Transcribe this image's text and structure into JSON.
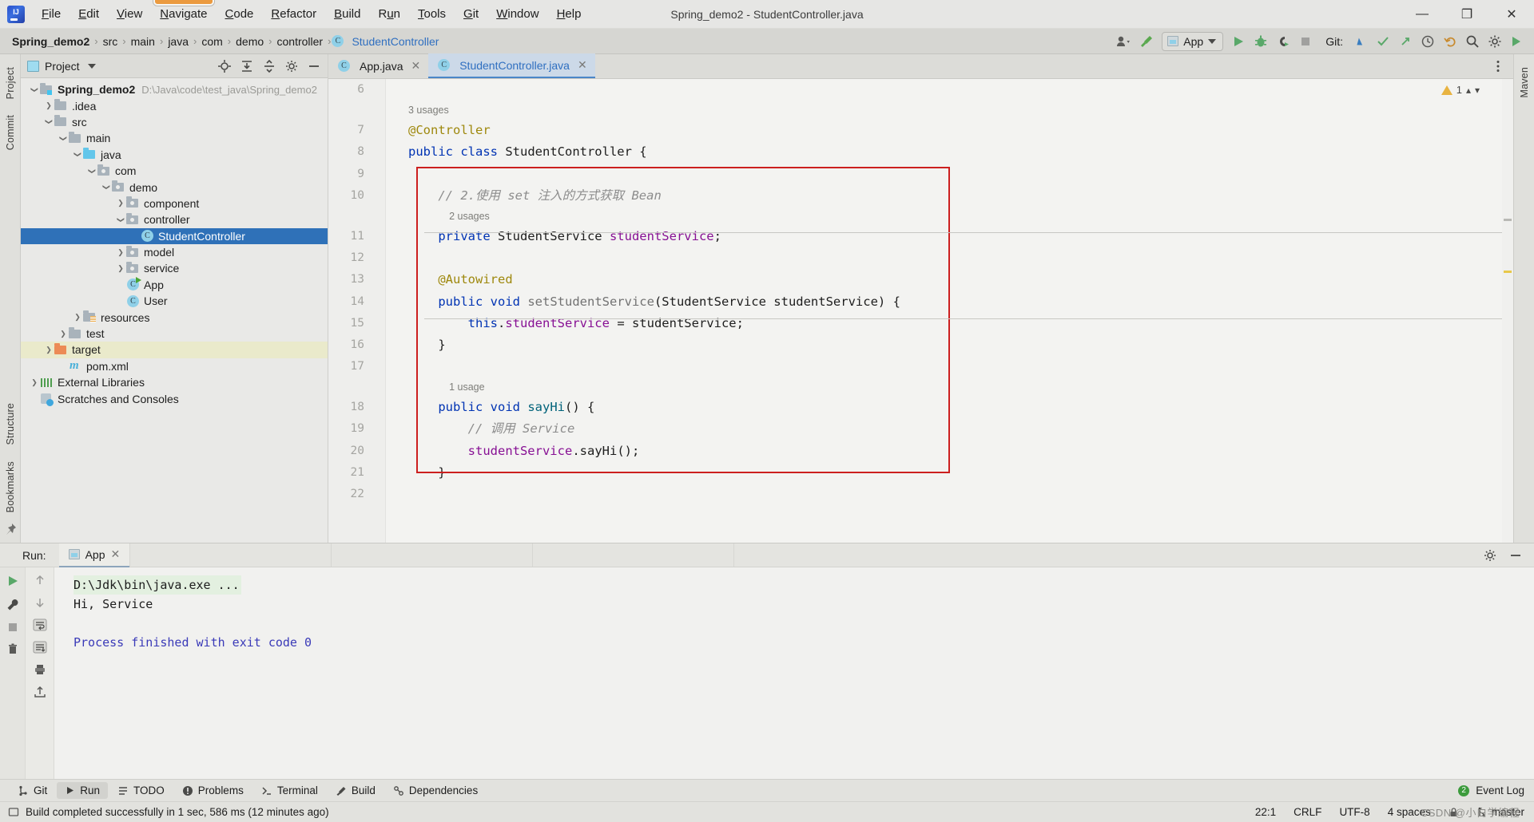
{
  "titlebar": {
    "app_icon": "intellij-logo-icon",
    "menus": [
      {
        "label": "File",
        "accel": "F"
      },
      {
        "label": "Edit",
        "accel": "E"
      },
      {
        "label": "View",
        "accel": "V"
      },
      {
        "label": "Navigate",
        "accel": "N",
        "selected": true
      },
      {
        "label": "Code",
        "accel": "C"
      },
      {
        "label": "Refactor",
        "accel": "R"
      },
      {
        "label": "Build",
        "accel": "B"
      },
      {
        "label": "Run",
        "accel": "u"
      },
      {
        "label": "Tools",
        "accel": "T"
      },
      {
        "label": "Git",
        "accel": "G"
      },
      {
        "label": "Window",
        "accel": "W"
      },
      {
        "label": "Help",
        "accel": "H"
      }
    ],
    "window_title": "Spring_demo2 - StudentController.java",
    "minimize": "—",
    "maximize": "❐",
    "close": "✕"
  },
  "navbar": {
    "breadcrumbs": [
      "Spring_demo2",
      "src",
      "main",
      "java",
      "com",
      "demo",
      "controller",
      "StudentController"
    ],
    "separator": "›",
    "class_badge": "C",
    "run_config": {
      "name": "App",
      "icon": "run-configuration-icon"
    },
    "git_label": "Git:",
    "icons": [
      "user-avatar-icon",
      "build-hammer-icon",
      "run-icon",
      "debug-icon",
      "run-with-coverage-icon",
      "stop-icon",
      "git-update-icon",
      "git-commit-icon",
      "git-push-icon",
      "history-icon",
      "undo-icon",
      "search-icon",
      "settings-icon",
      "plugin-icon"
    ]
  },
  "left_strip": {
    "tabs": [
      "Project",
      "Commit",
      "Structure",
      "Bookmarks"
    ],
    "pin_icon": "pin-icon"
  },
  "right_strip": {
    "tabs": [
      "Maven"
    ]
  },
  "project_panel": {
    "title": "Project",
    "actions": [
      "locate-icon",
      "expand-all-icon",
      "collapse-all-icon",
      "settings-icon",
      "hide-icon"
    ],
    "tree": [
      {
        "label": "Spring_demo2",
        "path": "D:\\Java\\code\\test_java\\Spring_demo2",
        "depth": 0,
        "arrow": "open",
        "icon": "project-folder",
        "bold": true
      },
      {
        "label": ".idea",
        "depth": 1,
        "arrow": "closed",
        "icon": "folder"
      },
      {
        "label": "src",
        "depth": 1,
        "arrow": "open",
        "icon": "folder"
      },
      {
        "label": "main",
        "depth": 2,
        "arrow": "open",
        "icon": "folder"
      },
      {
        "label": "java",
        "depth": 3,
        "arrow": "open",
        "icon": "folder-blue"
      },
      {
        "label": "com",
        "depth": 4,
        "arrow": "open",
        "icon": "package"
      },
      {
        "label": "demo",
        "depth": 5,
        "arrow": "open",
        "icon": "package"
      },
      {
        "label": "component",
        "depth": 6,
        "arrow": "closed",
        "icon": "package"
      },
      {
        "label": "controller",
        "depth": 6,
        "arrow": "open",
        "icon": "package"
      },
      {
        "label": "StudentController",
        "depth": 7,
        "arrow": "none",
        "icon": "class",
        "selected": true
      },
      {
        "label": "model",
        "depth": 6,
        "arrow": "closed",
        "icon": "package"
      },
      {
        "label": "service",
        "depth": 6,
        "arrow": "closed",
        "icon": "package"
      },
      {
        "label": "App",
        "depth": 6,
        "arrow": "none",
        "icon": "class-runnable"
      },
      {
        "label": "User",
        "depth": 6,
        "arrow": "none",
        "icon": "class"
      },
      {
        "label": "resources",
        "depth": 3,
        "arrow": "closed",
        "icon": "folder-resources"
      },
      {
        "label": "test",
        "depth": 2,
        "arrow": "closed",
        "icon": "folder"
      },
      {
        "label": "target",
        "depth": 1,
        "arrow": "closed",
        "icon": "folder-orange",
        "highlight": true
      },
      {
        "label": "pom.xml",
        "depth": 2,
        "arrow": "none",
        "icon": "maven"
      },
      {
        "label": "External Libraries",
        "depth": 0,
        "arrow": "closed",
        "icon": "library"
      },
      {
        "label": "Scratches and Consoles",
        "depth": 0,
        "arrow": "none",
        "icon": "scratch"
      }
    ]
  },
  "editor": {
    "tabs": [
      {
        "label": "App.java",
        "badge": "C",
        "active": false,
        "close": "✕"
      },
      {
        "label": "StudentController.java",
        "badge": "C",
        "active": true,
        "close": "✕"
      }
    ],
    "warning_count": "1",
    "line_numbers": [
      "6",
      "7",
      "8",
      "9",
      "10",
      "11",
      "12",
      "13",
      "14",
      "15",
      "16",
      "17",
      "18",
      "19",
      "20",
      "21",
      "22"
    ],
    "lines": [
      {
        "n": "6",
        "type": "code",
        "tokens": []
      },
      {
        "n": "",
        "type": "hint",
        "text": "3 usages"
      },
      {
        "n": "7",
        "type": "code",
        "tokens": [
          {
            "t": "@Controller",
            "c": "ann"
          }
        ]
      },
      {
        "n": "8",
        "type": "code",
        "tokens": [
          {
            "t": "public ",
            "c": "k"
          },
          {
            "t": "class ",
            "c": "k"
          },
          {
            "t": "StudentController {",
            "c": "cls"
          }
        ]
      },
      {
        "n": "9",
        "type": "code",
        "tokens": []
      },
      {
        "n": "10",
        "type": "code",
        "tokens": [
          {
            "t": "    // 2.使用 set 注入的方式获取 Bean",
            "c": "cmt"
          }
        ]
      },
      {
        "n": "",
        "type": "hint",
        "text": "2 usages",
        "indent": 4
      },
      {
        "n": "11",
        "type": "code",
        "tokens": [
          {
            "t": "    ",
            "c": "cls"
          },
          {
            "t": "private ",
            "c": "k"
          },
          {
            "t": "StudentService ",
            "c": "cls"
          },
          {
            "t": "studentService",
            "c": "fld"
          },
          {
            "t": ";",
            "c": "cls"
          }
        ]
      },
      {
        "n": "12",
        "type": "code",
        "tokens": []
      },
      {
        "n": "13",
        "type": "code",
        "tokens": [
          {
            "t": "    @Autowired",
            "c": "ann"
          }
        ]
      },
      {
        "n": "14",
        "type": "code",
        "tokens": [
          {
            "t": "    ",
            "c": "cls"
          },
          {
            "t": "public ",
            "c": "k"
          },
          {
            "t": "void ",
            "c": "k"
          },
          {
            "t": "setStudentService",
            "c": "greymth"
          },
          {
            "t": "(StudentService studentService) {",
            "c": "cls"
          }
        ]
      },
      {
        "n": "15",
        "type": "code",
        "tokens": [
          {
            "t": "        ",
            "c": "cls"
          },
          {
            "t": "this",
            "c": "k"
          },
          {
            "t": ".",
            "c": "cls"
          },
          {
            "t": "studentService",
            "c": "fld"
          },
          {
            "t": " = studentService;",
            "c": "cls"
          }
        ]
      },
      {
        "n": "16",
        "type": "code",
        "tokens": [
          {
            "t": "    }",
            "c": "cls"
          }
        ]
      },
      {
        "n": "17",
        "type": "code",
        "tokens": []
      },
      {
        "n": "",
        "type": "hint",
        "text": "1 usage",
        "indent": 4
      },
      {
        "n": "18",
        "type": "code",
        "tokens": [
          {
            "t": "    ",
            "c": "cls"
          },
          {
            "t": "public ",
            "c": "k"
          },
          {
            "t": "void ",
            "c": "k"
          },
          {
            "t": "sayHi",
            "c": "mth"
          },
          {
            "t": "() {",
            "c": "cls"
          }
        ]
      },
      {
        "n": "19",
        "type": "code",
        "tokens": [
          {
            "t": "        // 调用 Service",
            "c": "cmt"
          }
        ]
      },
      {
        "n": "20",
        "type": "code",
        "tokens": [
          {
            "t": "        ",
            "c": "cls"
          },
          {
            "t": "studentService",
            "c": "fld"
          },
          {
            "t": ".",
            "c": "cls"
          },
          {
            "t": "sayHi",
            "c": "cls"
          },
          {
            "t": "();",
            "c": "cls"
          }
        ]
      },
      {
        "n": "21",
        "type": "code",
        "tokens": [
          {
            "t": "    }",
            "c": "cls"
          }
        ]
      },
      {
        "n": "22",
        "type": "code",
        "tokens": []
      }
    ]
  },
  "run_panel": {
    "label": "Run:",
    "tab": {
      "name": "App",
      "close": "✕"
    },
    "tools": [
      "rerun-icon",
      "settings-wrench-icon",
      "stop-icon",
      "trash-icon"
    ],
    "tools2": [
      "scroll-up-icon",
      "scroll-down-icon",
      "soft-wrap-icon",
      "scroll-to-end-icon",
      "print-icon",
      "export-icon"
    ],
    "console": [
      {
        "text": "D:\\Jdk\\bin\\java.exe ...",
        "style": "cmd"
      },
      {
        "text": "Hi, Service",
        "style": "plain"
      },
      {
        "text": "",
        "style": "plain"
      },
      {
        "text": "Process finished with exit code 0",
        "style": "exit"
      }
    ],
    "header_icons": [
      "settings-icon",
      "hide-icon"
    ]
  },
  "toolwindow_bar": {
    "items": [
      {
        "label": "Git",
        "icon": "git-icon"
      },
      {
        "label": "Run",
        "icon": "run-icon",
        "active": true
      },
      {
        "label": "TODO",
        "icon": "todo-icon"
      },
      {
        "label": "Problems",
        "icon": "problems-icon"
      },
      {
        "label": "Terminal",
        "icon": "terminal-icon"
      },
      {
        "label": "Build",
        "icon": "build-icon"
      },
      {
        "label": "Dependencies",
        "icon": "dependencies-icon"
      }
    ],
    "event_log": {
      "label": "Event Log",
      "count": "2"
    }
  },
  "statusbar": {
    "message": "Build completed successfully in 1 sec, 586 ms (12 minutes ago)",
    "caret": "22:1",
    "line_sep": "CRLF",
    "encoding": "UTF-8",
    "indent": "4 spaces",
    "branch": "master",
    "lock_icon": "lock-icon",
    "branch_icon": "git-branch-icon"
  },
  "watermark": "CSDN @小白学编程"
}
